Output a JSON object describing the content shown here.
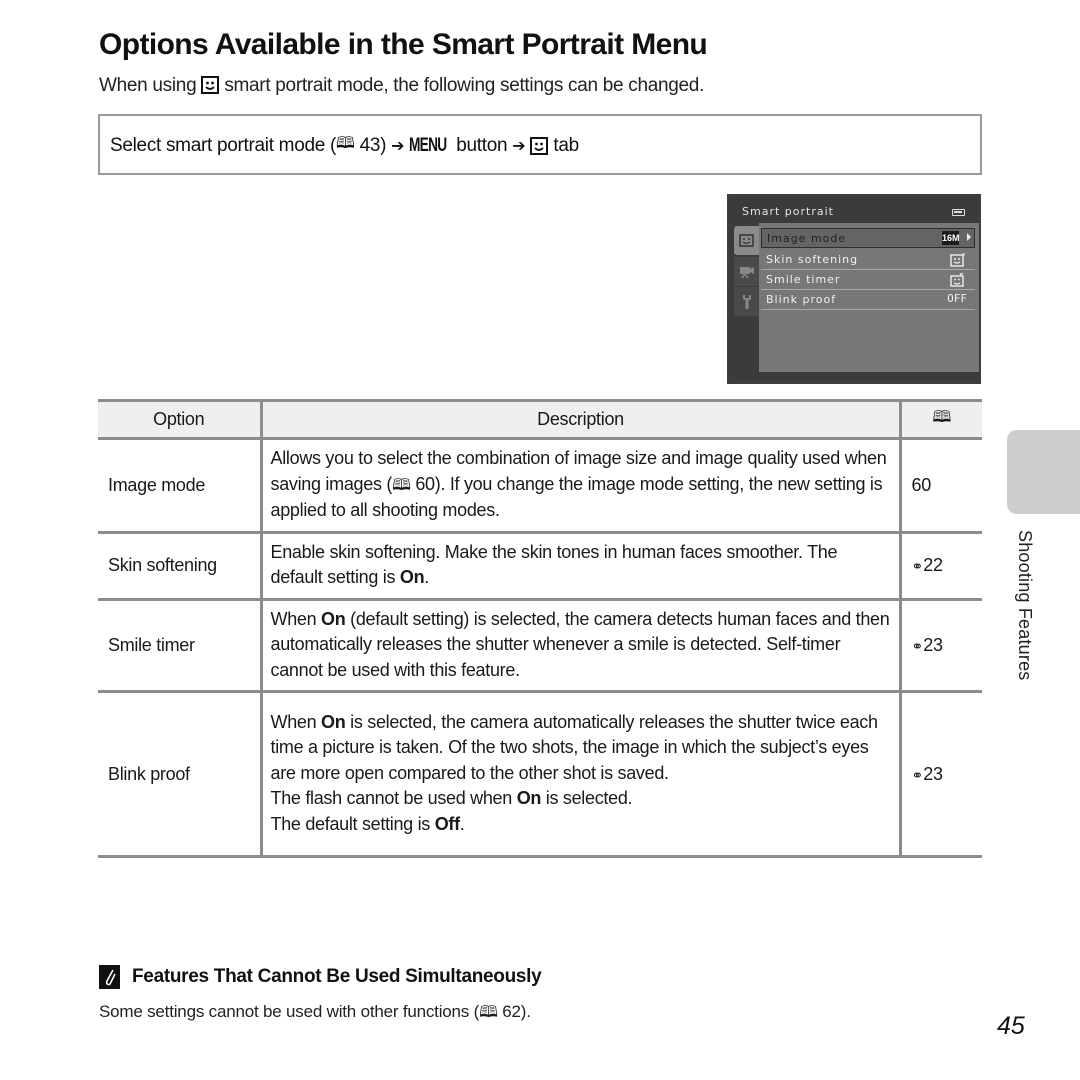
{
  "page": {
    "title": "Options Available in the Smart Portrait Menu",
    "intro_before": "When using",
    "intro_after": "smart portrait mode, the following settings can be changed.",
    "page_number": "45",
    "side_tab_label": "Shooting Features"
  },
  "navigation": {
    "step1": "Select smart portrait mode (",
    "step1_ref": "43)",
    "arrow": "➔",
    "menu_word": "MENU",
    "step2": "button",
    "step3": "tab"
  },
  "camera_screen": {
    "title": "Smart portrait",
    "items": [
      {
        "label": "Image mode",
        "value": "16M",
        "selected": true
      },
      {
        "label": "Skin softening",
        "value": "skin-softening-icon"
      },
      {
        "label": "Smile timer",
        "value": "smile-timer-icon"
      },
      {
        "label": "Blink proof",
        "value": "OFF"
      }
    ]
  },
  "table": {
    "headers": {
      "option": "Option",
      "description": "Description",
      "reference": "book-icon"
    },
    "rows": [
      {
        "option": "Image mode",
        "desc": [
          {
            "t": "Allows you to select the combination of image size and image quality used when saving images ("
          },
          {
            "t": "60). If you change the image mode setting, the new setting is applied to all shooting modes."
          }
        ],
        "ref": "60"
      },
      {
        "option": "Skin softening",
        "desc_plain": "Enable skin softening. Make the skin tones in human faces smoother. The default setting is ",
        "desc_bold": "On",
        "desc_end": ".",
        "ref": "22"
      },
      {
        "option": "Smile timer",
        "desc_start": "When ",
        "desc_bold": "On",
        "desc_end": " (default setting) is selected, the camera detects human faces and then automatically releases the shutter whenever a smile is detected. Self-timer cannot be used with this feature.",
        "ref": "23"
      },
      {
        "option": "Blink proof",
        "line1_start": "When ",
        "line1_bold": "On",
        "line1_end": " is selected, the camera automatically releases the shutter twice each time a picture is taken. Of the two shots, the image in which the subject’s eyes are more open compared to the other shot is saved.",
        "line2_start": "The flash cannot be used when ",
        "line2_bold": "On",
        "line2_end": " is selected.",
        "line3_start": "The default setting is ",
        "line3_bold": "Off",
        "line3_end": ".",
        "ref": "23"
      }
    ]
  },
  "note": {
    "title": "Features That Cannot Be Used Simultaneously",
    "body_start": "Some settings cannot be used with other functions (",
    "body_ref": "62)."
  }
}
